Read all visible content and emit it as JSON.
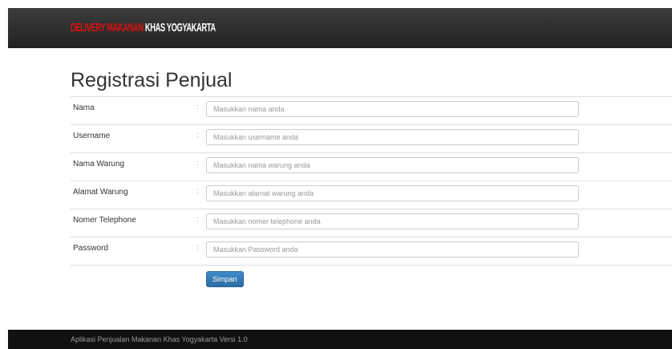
{
  "navbar": {
    "brand_part1": "DELIVERY MAKANAN",
    "brand_part2": "KHAS YOGYAKARTA"
  },
  "page": {
    "title": "Registrasi Penjual"
  },
  "form": {
    "separator": ":",
    "fields": [
      {
        "label": "Nama",
        "placeholder": "Masukkan nama anda",
        "value": ""
      },
      {
        "label": "Username",
        "placeholder": "Masukkan username anda",
        "value": ""
      },
      {
        "label": "Nama Warung",
        "placeholder": "Masukkan nama warung anda",
        "value": ""
      },
      {
        "label": "Alamat Warung",
        "placeholder": "Masukkan alamat warung anda",
        "value": ""
      },
      {
        "label": "Nomer Telephone",
        "placeholder": "Masukkan nomer telephone anda",
        "value": ""
      },
      {
        "label": "Password",
        "placeholder": "Masukkan Password anda",
        "value": ""
      }
    ],
    "submit_label": "Simpan"
  },
  "footer": {
    "text": "Aplikasi Penjualan Makanan Khas Yogyakarta Versi 1.0"
  },
  "colors": {
    "navbar_bg": "#2a2a2a",
    "brand_red": "#e01010",
    "button_blue": "#337ab7",
    "footer_bg": "#111111"
  }
}
